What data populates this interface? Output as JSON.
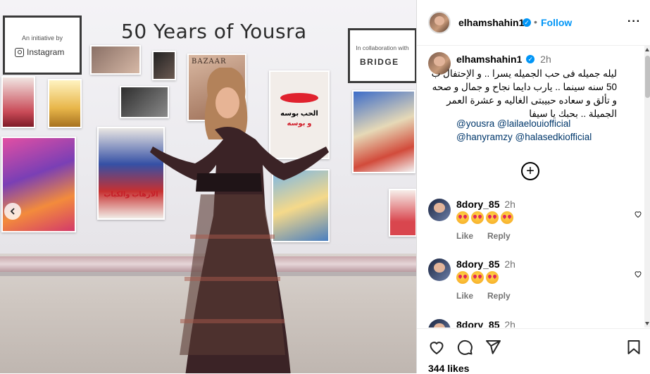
{
  "photo": {
    "banner_title": "50 Years of Yousra",
    "sign_left_small": "An initiative by",
    "sign_left_brand": "Instagram",
    "sign_right_small": "In collaboration with",
    "sign_right_brand": "BRIDGE",
    "poster_big_word": "BAZAAR",
    "poster_arabic_1": "الحب بوسه",
    "poster_arabic_2": "و بوسه",
    "poster_arabic_3": "الارهاب والكباب"
  },
  "post_header": {
    "username": "elhamshahin1",
    "verified_icon": "verified-badge-icon",
    "separator": "•",
    "follow_label": "Follow",
    "more_icon": "more-options-icon",
    "more_label": "···"
  },
  "caption": {
    "username": "elhamshahin1",
    "time": "2h",
    "text": "ليله جميله فى حب الجميله يسرا .. و الإحتفال ب 50 سنه سينما .. يارب دايما نجاح و جمال و صحه و تألق و سعاده حبيبتى الغاليه و عشرة العمر الجميلة .. بحبك يا سيفا",
    "mentions": [
      "@yousra",
      "@lailaelouiofficial",
      "@hanyramzy",
      "@halasedkiofficial"
    ]
  },
  "load_more_icon": "plus-circle-icon",
  "load_more_label": "+",
  "comments": [
    {
      "username": "8dory_85",
      "time": "2h",
      "emoji_count": 4,
      "like_label": "Like",
      "reply_label": "Reply"
    },
    {
      "username": "8dory_85",
      "time": "2h",
      "emoji_count": 3,
      "like_label": "Like",
      "reply_label": "Reply"
    },
    {
      "username": "8dory_85",
      "time": "2h"
    }
  ],
  "actions": {
    "like_icon": "heart-icon",
    "comment_icon": "comment-icon",
    "share_icon": "share-icon",
    "save_icon": "bookmark-icon"
  },
  "likes_label": "344 likes",
  "colors": {
    "accent": "#0095f6",
    "mention": "#00376b",
    "muted": "#737373"
  }
}
